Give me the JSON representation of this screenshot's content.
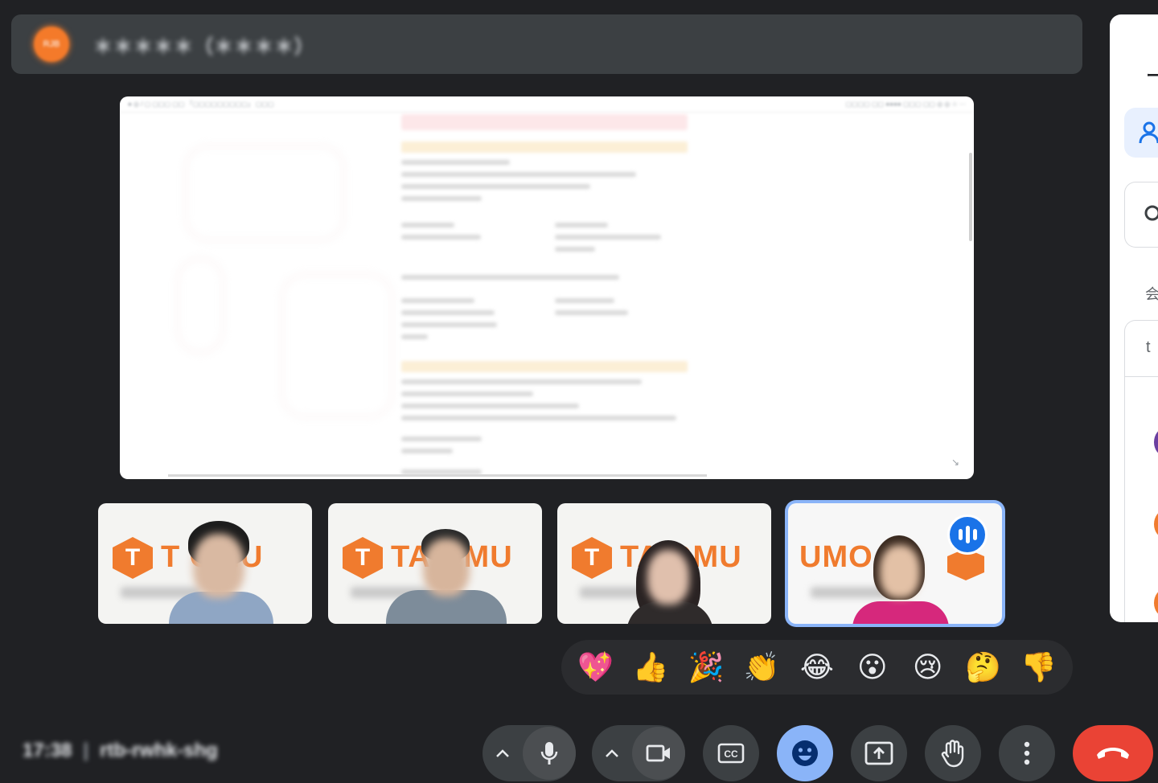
{
  "header": {
    "avatar_text": "RJB",
    "meeting_title": "＊＊＊＊＊（＊＊＊＊）"
  },
  "side_panel": {
    "title": "ー",
    "section_label": "会",
    "card_label": "t"
  },
  "presentation": {
    "toolbar_left": "● ◎  / ▢  ▢▢▢  ▢▢  「▢▢▢▢▢▢▢▢▢」 ▢▢▢",
    "toolbar_right": "▢▢▢▢ ▢▢  ●●●●  ▢▢▢ ▢▢ ◎ ◎ ☆ ⋯"
  },
  "participants": [
    {
      "brand": "TAKUMU",
      "visible_brand": "T    OMU",
      "name": "＊＊＊＊",
      "speaking": false
    },
    {
      "brand": "TAKUMU",
      "visible_brand": "TA    OMU",
      "name": "＊＊＊＊",
      "speaking": false
    },
    {
      "brand": "TAKUMU",
      "visible_brand": "TA    OMU",
      "name": "＊＊＊＊",
      "speaking": false
    },
    {
      "brand": "UMOT",
      "visible_brand": "UMO      T",
      "name": "＊＊＊＊",
      "speaking": true
    }
  ],
  "reactions": [
    {
      "name": "sparkling-heart",
      "emoji": "💖"
    },
    {
      "name": "thumbs-up",
      "emoji": "👍"
    },
    {
      "name": "party-popper",
      "emoji": "🎉"
    },
    {
      "name": "clapping-hands",
      "emoji": "👏"
    },
    {
      "name": "tears-of-joy",
      "emoji": "😂"
    },
    {
      "name": "surprised",
      "emoji": "😮"
    },
    {
      "name": "crying",
      "emoji": "😢"
    },
    {
      "name": "thinking",
      "emoji": "🤔"
    },
    {
      "name": "thumbs-down",
      "emoji": "👎"
    }
  ],
  "footer": {
    "time": "17:38",
    "separator": "|",
    "meeting_code": "rtb-rwhk-shg"
  },
  "colors": {
    "background": "#202124",
    "brand_orange": "#f07b2e",
    "accent_blue": "#8ab4f8",
    "end_call_red": "#ea4335",
    "speaking_badge": "#1a73e8"
  }
}
